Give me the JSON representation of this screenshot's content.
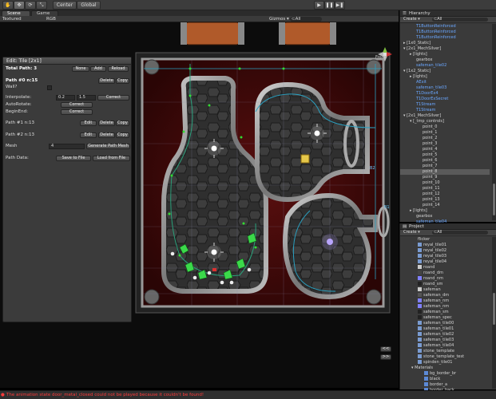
{
  "toolbar": {
    "hand": "✋",
    "move": "✥",
    "rotate": "⟳",
    "scale": "⤡",
    "center": "Center",
    "global": "Global",
    "play": "▶",
    "pause": "❚❚",
    "step": "▶❚"
  },
  "tabs": {
    "scene": "Scene",
    "game": "Game",
    "hierarchy": "Hierarchy",
    "project": "Project"
  },
  "scene_bar": {
    "render_mode": "Textured",
    "color_mode": "RGB",
    "gizmos": "Gizmos ▾",
    "search": "⊂All"
  },
  "view_label": "Front",
  "edit_panel": {
    "title": "Edit: Tile [2x1]",
    "total_path_label": "Total Path: 3",
    "none": "None",
    "add": "Add",
    "reload": "Reload",
    "path0_label": "Path #0 n:15",
    "delete": "Delete",
    "copy": "Copy",
    "wall_label": "Wall?",
    "interpolate_label": "Interpolate:",
    "interp_a": "0.2",
    "interp_b": "1.5",
    "correct": "Correct",
    "autorotate_label": "AutoRotate:",
    "beginend_label": "BeginEnd:",
    "path1_label": "Path #1 n:13",
    "path2_label": "Path #2 n:13",
    "edit": "Edit",
    "mesh_label": "Mesh",
    "mesh_value": "4",
    "generate_mesh": "Generate Path Mesh",
    "pathdata_label": "Path Data:",
    "save_to_file": "Save to File",
    "load_from_file": "Load from File"
  },
  "scene_markers": {
    "b2": "B2",
    "b1": "B1",
    "nav_left": "<<",
    "nav_right": ">>"
  },
  "hierarchy": {
    "create": "Create ▾",
    "search": "⊂All",
    "items": [
      {
        "text": "T1ButtonReinforced",
        "indent": 20,
        "blue": true
      },
      {
        "text": "T1ButtonReinforced",
        "indent": 20,
        "blue": true
      },
      {
        "text": "T1ButtonReinforced",
        "indent": 20,
        "blue": true
      },
      {
        "text": "▸ [1x0_Static]",
        "indent": 4,
        "blue": false
      },
      {
        "text": "▾ [2x1_MechSilver]",
        "indent": 4,
        "blue": false
      },
      {
        "text": "▸ [lights]",
        "indent": 12,
        "blue": false
      },
      {
        "text": "gearbox",
        "indent": 20,
        "blue": false
      },
      {
        "text": "safeman_tile02",
        "indent": 20,
        "blue": true
      },
      {
        "text": "▾ [1x2_Static]",
        "indent": 4,
        "blue": false
      },
      {
        "text": "▸ [lights]",
        "indent": 12,
        "blue": false
      },
      {
        "text": "AExit",
        "indent": 20,
        "blue": true
      },
      {
        "text": "safeman_tile03",
        "indent": 20,
        "blue": true
      },
      {
        "text": "T1DoorEx4",
        "indent": 20,
        "blue": true
      },
      {
        "text": "T1DoorExSecret",
        "indent": 20,
        "blue": true
      },
      {
        "text": "T1Stream",
        "indent": 20,
        "blue": true
      },
      {
        "text": "T1Stream",
        "indent": 20,
        "blue": true
      },
      {
        "text": "▾ [2x1_MechSilver]",
        "indent": 4,
        "blue": false
      },
      {
        "text": "▾ [_tmp_controls]",
        "indent": 12,
        "blue": false
      },
      {
        "text": "point_0",
        "indent": 28,
        "blue": false
      },
      {
        "text": "point_1",
        "indent": 28,
        "blue": false
      },
      {
        "text": "point_2",
        "indent": 28,
        "blue": false
      },
      {
        "text": "point_3",
        "indent": 28,
        "blue": false
      },
      {
        "text": "point_4",
        "indent": 28,
        "blue": false
      },
      {
        "text": "point_5",
        "indent": 28,
        "blue": false
      },
      {
        "text": "point_6",
        "indent": 28,
        "blue": false
      },
      {
        "text": "point_7",
        "indent": 28,
        "blue": false
      },
      {
        "text": "point_8",
        "indent": 28,
        "blue": false,
        "selected": true
      },
      {
        "text": "point_9",
        "indent": 28,
        "blue": false
      },
      {
        "text": "point_10",
        "indent": 28,
        "blue": false
      },
      {
        "text": "point_11",
        "indent": 28,
        "blue": false
      },
      {
        "text": "point_12",
        "indent": 28,
        "blue": false
      },
      {
        "text": "point_13",
        "indent": 28,
        "blue": false
      },
      {
        "text": "point_14",
        "indent": 28,
        "blue": false
      },
      {
        "text": "▸ [lights]",
        "indent": 12,
        "blue": false
      },
      {
        "text": "gearbox",
        "indent": 20,
        "blue": false
      },
      {
        "text": "safeman_tile04",
        "indent": 20,
        "blue": true
      }
    ]
  },
  "project": {
    "create": "Create ▾",
    "search": "⊂All",
    "items": [
      {
        "text": "flicker",
        "indent": 22,
        "swatch": ""
      },
      {
        "text": "reyal_tile01",
        "indent": 22,
        "swatch": "#7a9bd1"
      },
      {
        "text": "reyal_tile02",
        "indent": 22,
        "swatch": "#7a9bd1"
      },
      {
        "text": "reyal_tile03",
        "indent": 22,
        "swatch": "#7a9bd1"
      },
      {
        "text": "reyal_tile04",
        "indent": 22,
        "swatch": "#7a9bd1"
      },
      {
        "text": "roand",
        "indent": 22,
        "swatch": "#cccccc"
      },
      {
        "text": "roand_dm",
        "indent": 22,
        "swatch": "#444444"
      },
      {
        "text": "roand_nm",
        "indent": 22,
        "swatch": "#8080ff"
      },
      {
        "text": "roand_sm",
        "indent": 22,
        "swatch": "#222222"
      },
      {
        "text": "safeman",
        "indent": 22,
        "swatch": "#cccccc"
      },
      {
        "text": "safeman_dm",
        "indent": 22,
        "swatch": "#555555"
      },
      {
        "text": "safeman_nm",
        "indent": 22,
        "swatch": "#8080ff"
      },
      {
        "text": "safeman_nm",
        "indent": 22,
        "swatch": "#8080ff"
      },
      {
        "text": "safeman_sm",
        "indent": 22,
        "swatch": "#222222"
      },
      {
        "text": "safeman_spec",
        "indent": 22,
        "swatch": "#222222"
      },
      {
        "text": "safeman_tile00",
        "indent": 22,
        "swatch": "#7a9bd1"
      },
      {
        "text": "safeman_tile01",
        "indent": 22,
        "swatch": "#7a9bd1"
      },
      {
        "text": "safeman_tile02",
        "indent": 22,
        "swatch": "#7a9bd1"
      },
      {
        "text": "safeman_tile03",
        "indent": 22,
        "swatch": "#7a9bd1"
      },
      {
        "text": "safeman_tile04",
        "indent": 22,
        "swatch": "#7a9bd1"
      },
      {
        "text": "stone_template",
        "indent": 22,
        "swatch": "#7a9bd1"
      },
      {
        "text": "stone_template_test",
        "indent": 22,
        "swatch": "#7a9bd1"
      },
      {
        "text": "spinden_tile01",
        "indent": 22,
        "swatch": "#7a9bd1"
      },
      {
        "text": "▾ Materials",
        "indent": 14,
        "swatch": ""
      },
      {
        "text": "bg_border_br",
        "indent": 30,
        "swatch": "#5c8ad6"
      },
      {
        "text": "black",
        "indent": 30,
        "swatch": "#5c8ad6"
      },
      {
        "text": "border_a",
        "indent": 30,
        "swatch": "#5c8ad6"
      },
      {
        "text": "border_back",
        "indent": 30,
        "swatch": "#5c8ad6"
      }
    ]
  },
  "status_message": "The animation state door_metal_closed could not be played because it couldn't be found!"
}
